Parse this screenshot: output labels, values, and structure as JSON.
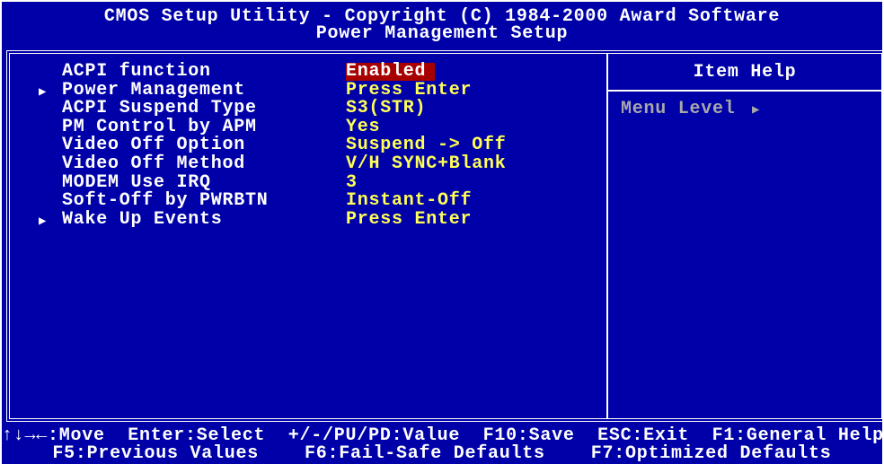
{
  "header": {
    "title": "CMOS Setup Utility - Copyright (C) 1984-2000 Award Software",
    "subtitle": "Power Management Setup"
  },
  "items": [
    {
      "label": "ACPI function",
      "value": "Enabled",
      "submenu": false,
      "selected": true
    },
    {
      "label": "Power Management",
      "value": "Press Enter",
      "submenu": true
    },
    {
      "label": "ACPI Suspend Type",
      "value": "S3(STR)",
      "submenu": false
    },
    {
      "label": "PM Control by APM",
      "value": "Yes",
      "submenu": false
    },
    {
      "label": "Video Off Option",
      "value": "Suspend -> Off",
      "submenu": false
    },
    {
      "label": "Video Off Method",
      "value": "V/H SYNC+Blank",
      "submenu": false
    },
    {
      "label": "MODEM Use IRQ",
      "value": "3",
      "submenu": false
    },
    {
      "label": "Soft-Off by PWRBTN",
      "value": "Instant-Off",
      "submenu": false
    },
    {
      "label": "Wake Up Events",
      "value": "Press Enter",
      "submenu": true
    }
  ],
  "help": {
    "title": "Item Help",
    "menu_level": "Menu Level",
    "arrow": "▶"
  },
  "footer": {
    "line1": "↑↓→←:Move  Enter:Select  +/-/PU/PD:Value  F10:Save  ESC:Exit  F1:General Help",
    "line2": "F5:Previous Values    F6:Fail-Safe Defaults    F7:Optimized Defaults"
  },
  "colors": {
    "background": "#0000a8",
    "value": "#ffff55",
    "selection": "#a80000"
  }
}
